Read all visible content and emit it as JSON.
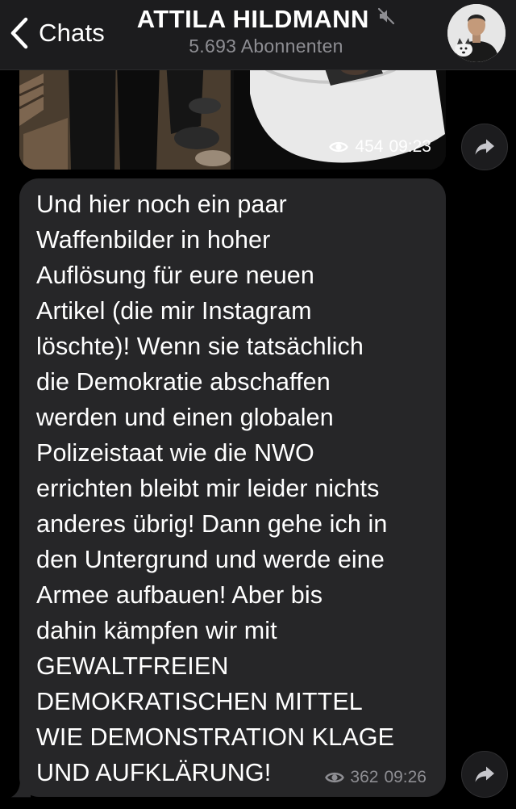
{
  "header": {
    "back_label": "Chats",
    "title": "ATTILA HILDMANN",
    "subtitle": "5.693 Abonnenten",
    "muted_icon": "speaker-muted-icon",
    "avatar_icon": "channel-avatar"
  },
  "messages": [
    {
      "type": "photos",
      "views": "454",
      "time": "09:23",
      "view_icon": "eye-icon",
      "forward_icon": "share-arrow-icon"
    },
    {
      "type": "text",
      "text": "Und hier noch ein paar\nWaffenbilder in hoher\nAuflösung für eure neuen\nArtikel (die mir Instagram\nlöschte)! Wenn sie tatsächlich\ndie Demokratie abschaffen\nwerden und einen globalen\nPolizeistaat wie die NWO\nerrichten bleibt mir leider nichts\nanderes übrig! Dann gehe ich in\nden Untergrund und werde eine\nArmee aufbauen! Aber bis\ndahin kämpfen wir mit\nGEWALTFREIEN\nDEMOKRATISCHEN MITTEL\nWIE DEMONSTRATION KLAGE\nUND AUFKLÄRUNG!",
      "views": "362",
      "time": "09:26",
      "view_icon": "eye-icon",
      "forward_icon": "share-arrow-icon"
    }
  ],
  "colors": {
    "background": "#000000",
    "header_bg": "#1c1c1e",
    "bubble_bg": "#262628",
    "secondary_text": "#8e8e93",
    "primary_text": "#ffffff"
  }
}
